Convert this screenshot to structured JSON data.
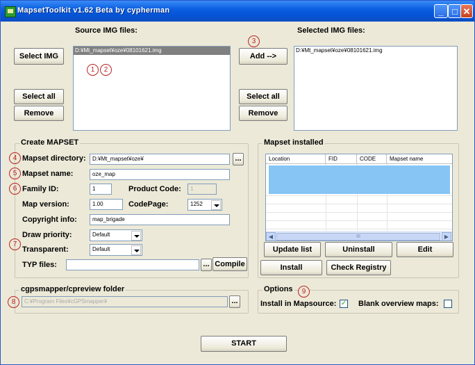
{
  "window": {
    "title": "MapsetToolkit v1.62 Beta by cypherman",
    "minimize": "_",
    "maximize": "□",
    "close": "✕"
  },
  "annotations": [
    "1",
    "2",
    "3",
    "4",
    "5",
    "6",
    "7",
    "8",
    "9"
  ],
  "source": {
    "label": "Source IMG files:",
    "select_img": "Select IMG",
    "items": [
      "D:¥Mt_mapset¥oze¥08101621.img"
    ],
    "select_all": "Select all",
    "remove": "Remove"
  },
  "middle": {
    "add": "Add -->",
    "select_all": "Select all",
    "remove": "Remove"
  },
  "selected": {
    "label": "Selected IMG files:",
    "items": [
      "D:¥Mt_mapset¥oze¥08101621.img"
    ]
  },
  "create": {
    "group_title": "Create MAPSET",
    "mapset_directory_label": "Mapset directory:",
    "mapset_directory_value": "D:¥Mt_mapset¥oze¥",
    "browse": "...",
    "mapset_name_label": "Mapset name:",
    "mapset_name_value": "oze_map",
    "family_id_label": "Family ID:",
    "family_id_value": "1",
    "product_code_label": "Product Code:",
    "product_code_value": "1",
    "map_version_label": "Map version:",
    "map_version_value": "1.00",
    "codepage_label": "CodePage:",
    "codepage_value": "1252",
    "copyright_label": "Copyright info:",
    "copyright_value": "map_brigade",
    "draw_priority_label": "Draw priority:",
    "draw_priority_value": "Default",
    "transparent_label": "Transparent:",
    "transparent_value": "Default",
    "typ_label": "TYP files:",
    "typ_value": "",
    "typ_browse": "...",
    "compile": "Compile"
  },
  "installed": {
    "group_title": "Mapset installed",
    "columns": [
      "Location",
      "FID",
      "CODE",
      "Mapset name"
    ],
    "scroll_thumb": "III",
    "update_list": "Update list",
    "uninstall": "Uninstall",
    "edit": "Edit",
    "install": "Install",
    "check_registry": "Check Registry",
    "redaction_color": "#87c5f5"
  },
  "cgps": {
    "group_title": "cgpsmapper/cpreview folder",
    "path": "C:¥Program Files¥cGPSmapper¥",
    "browse": "..."
  },
  "options": {
    "group_title": "Options",
    "install_in_mapsource_label": "Install in Mapsource:",
    "install_in_mapsource_checked": "✓",
    "blank_overview_label": "Blank overview maps:",
    "blank_overview_checked": ""
  },
  "start": "START"
}
